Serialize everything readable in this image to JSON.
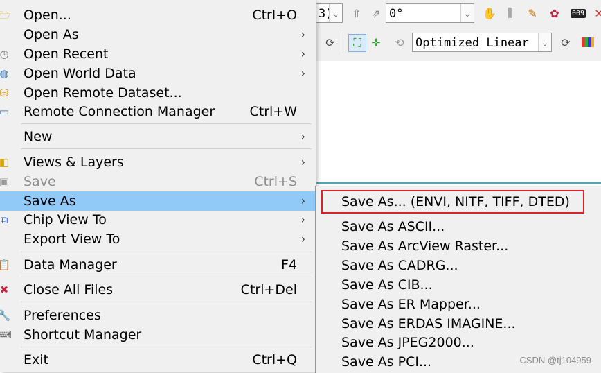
{
  "toolbar": {
    "row1": {
      "combo1_value": "3)",
      "rotation_value": "0°",
      "icons": [
        "rotate-up-icon",
        "rotate-right-icon",
        "hand-gesture-icon",
        "spectral-icon",
        "pencil-roi-icon",
        "roi-tool-icon",
        "counter-icon",
        "close-icon"
      ],
      "counter_text": "009"
    },
    "row2": {
      "stretch_value": "Optimized Linear",
      "icons": [
        "refresh-icon",
        "zoom-fit-icon",
        "crosshair-icon",
        "cycle-icon",
        "refresh-icon",
        "color-table-icon"
      ]
    }
  },
  "menu": {
    "items": [
      {
        "icon": "folder-open-icon",
        "label": "Open...",
        "shortcut": "Ctrl+O",
        "submenu": false
      },
      {
        "icon": "",
        "label": "Open As",
        "shortcut": "",
        "submenu": true
      },
      {
        "icon": "recent-icon",
        "label": "Open Recent",
        "shortcut": "",
        "submenu": true
      },
      {
        "icon": "globe-icon",
        "label": "Open World Data",
        "shortcut": "",
        "submenu": true
      },
      {
        "icon": "remote-dataset-icon",
        "label": "Open Remote Dataset...",
        "shortcut": "",
        "submenu": false
      },
      {
        "icon": "monitor-icon",
        "label": "Remote Connection Manager",
        "shortcut": "Ctrl+W",
        "submenu": false
      },
      {
        "icon": "",
        "label": "New",
        "shortcut": "",
        "submenu": true
      },
      {
        "icon": "layers-icon",
        "label": "Views & Layers",
        "shortcut": "",
        "submenu": true
      },
      {
        "icon": "save-disk-icon",
        "label": "Save",
        "shortcut": "Ctrl+S",
        "submenu": false,
        "disabled": true
      },
      {
        "icon": "",
        "label": "Save As",
        "shortcut": "",
        "submenu": true,
        "highlighted": true
      },
      {
        "icon": "chip-view-icon",
        "label": "Chip View To",
        "shortcut": "",
        "submenu": true
      },
      {
        "icon": "",
        "label": "Export View To",
        "shortcut": "",
        "submenu": true
      },
      {
        "icon": "clipboard-icon",
        "label": "Data Manager",
        "shortcut": "F4",
        "submenu": false
      },
      {
        "icon": "close-files-icon",
        "label": "Close All Files",
        "shortcut": "Ctrl+Del",
        "submenu": false
      },
      {
        "icon": "wrench-icon",
        "label": "Preferences",
        "shortcut": "",
        "submenu": false
      },
      {
        "icon": "keyboard-icon",
        "label": "Shortcut Manager",
        "shortcut": "",
        "submenu": false
      },
      {
        "icon": "",
        "label": "Exit",
        "shortcut": "Ctrl+Q",
        "submenu": false
      }
    ]
  },
  "save_as_submenu": {
    "items": [
      "Save As... (ENVI, NITF, TIFF, DTED)",
      "Save As ASCII...",
      "Save As ArcView Raster...",
      "Save As CADRG...",
      "Save As CIB...",
      "Save As ER Mapper...",
      "Save As ERDAS IMAGINE...",
      "Save As JPEG2000...",
      "Save As PCI..."
    ],
    "highlight_color": "#d9232a"
  },
  "watermark": "CSDN @tj104959",
  "colors": {
    "menu_bg": "#f0f0f0",
    "hover": "#91c9f7",
    "accent_line": "#37b3c7"
  }
}
